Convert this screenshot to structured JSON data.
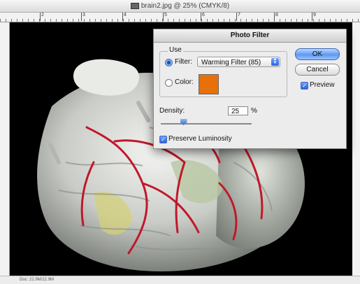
{
  "window": {
    "title": "brain2.jpg @ 25% (CMYK/8)"
  },
  "ruler": {
    "ticks": [
      "2",
      "3",
      "4",
      "5",
      "6",
      "7",
      "8",
      "9"
    ]
  },
  "statusbar": {
    "text": "Doc: 22.9M/22.9M"
  },
  "dialog": {
    "title": "Photo Filter",
    "use_label": "Use",
    "filter_label": "Filter:",
    "filter_value": "Warming Filter (85)",
    "color_label": "Color:",
    "color_swatch": "#e8700a",
    "selected_option": "Filter",
    "ok_label": "OK",
    "cancel_label": "Cancel",
    "preview_label": "Preview",
    "preview_checked": true,
    "density_label": "Density:",
    "density_value": "25",
    "density_unit": "%",
    "density_level": 0.25,
    "preserve_label": "Preserve Luminosity",
    "preserve_checked": true
  }
}
